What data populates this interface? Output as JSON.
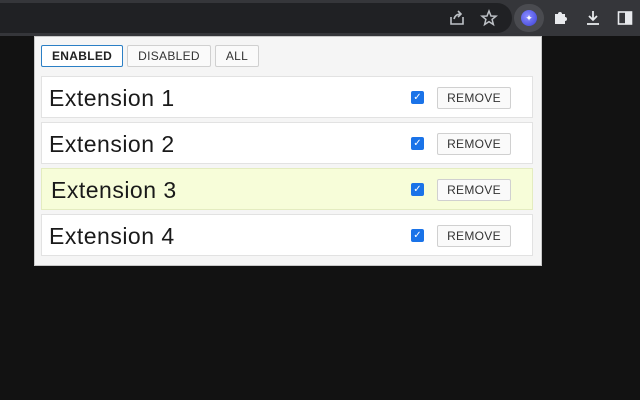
{
  "toolbar": {
    "icons": [
      "share-icon",
      "bookmark-star-icon",
      "active-extension-icon",
      "extensions-puzzle-icon",
      "download-icon",
      "side-panel-icon"
    ]
  },
  "popup": {
    "tabs": [
      {
        "label": "ENABLED",
        "active": true
      },
      {
        "label": "DISABLED",
        "active": false
      },
      {
        "label": "ALL",
        "active": false
      }
    ],
    "extensions": [
      {
        "name": "Extension 1",
        "enabled": true,
        "remove_label": "REMOVE"
      },
      {
        "name": "Extension 2",
        "enabled": true,
        "remove_label": "REMOVE"
      },
      {
        "name": "Extension 3",
        "enabled": true,
        "remove_label": "REMOVE",
        "highlighted": true
      },
      {
        "name": "Extension 4",
        "enabled": true,
        "remove_label": "REMOVE"
      }
    ]
  },
  "colors": {
    "accent": "#1a73e8",
    "active_tab_border": "#2b7fc5",
    "highlight_row": "#f7fdd9",
    "toolbar": "#35363a",
    "background": "#121212"
  }
}
